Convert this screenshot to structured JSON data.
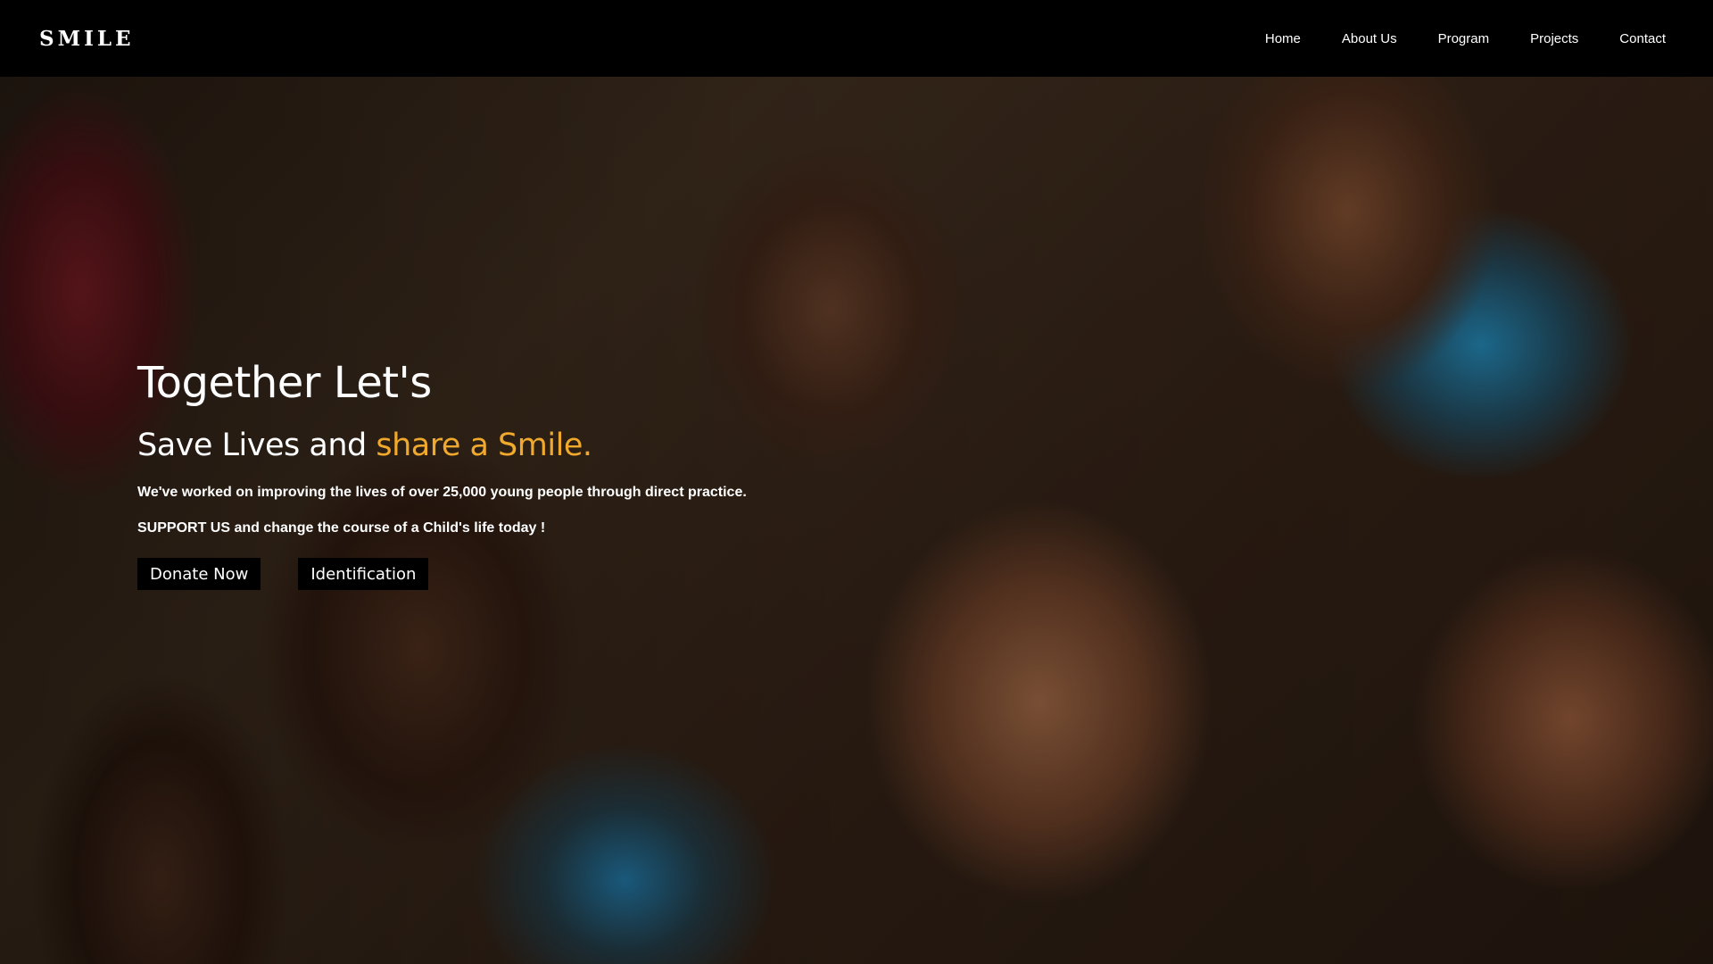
{
  "nav": {
    "brand": "SMILE",
    "links": [
      "Home",
      "About Us",
      "Program",
      "Projects",
      "Contact"
    ]
  },
  "hero": {
    "title": "Together Let's",
    "subtitle_prefix": "Save Lives and ",
    "subtitle_accent": "share a Smile.",
    "line1": "We've worked on improving the lives of over 25,000 young people through direct practice.",
    "line2": "SUPPORT US and change the course of a Child's life today !",
    "buttons": {
      "donate": "Donate Now",
      "identification": "Identification"
    }
  },
  "colors": {
    "accent": "#f0a92c",
    "navbar_bg": "#000000",
    "button_bg": "#000000"
  }
}
